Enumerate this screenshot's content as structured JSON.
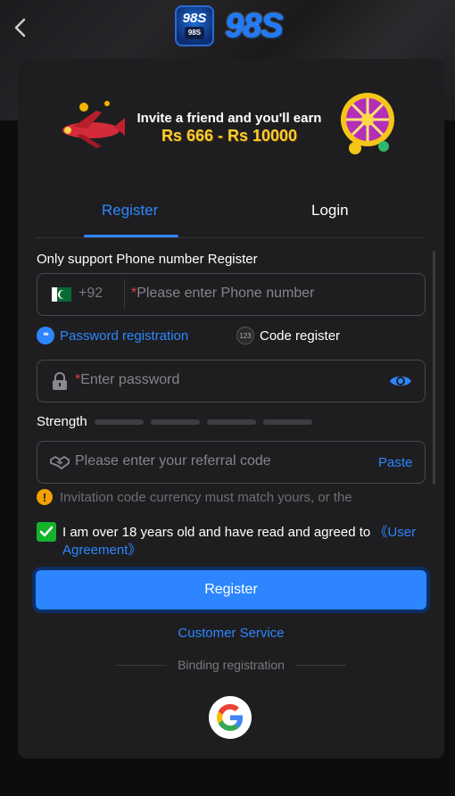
{
  "header": {
    "logo_badge_text": "98S",
    "logo_badge_sub": "98S",
    "logo_text": "98S"
  },
  "banner": {
    "line1": "Invite a friend and you'll earn",
    "line2": "Rs 666 - Rs 10000"
  },
  "tabs": {
    "register": "Register",
    "login": "Login",
    "active": "register"
  },
  "form": {
    "note": "Only support Phone number Register",
    "phone": {
      "country_code": "+92",
      "required_mark": "*",
      "placeholder": "Please enter Phone number"
    },
    "modes": {
      "password_label": "Password registration",
      "password_icon_text": "**",
      "code_label": "Code register",
      "code_icon_text": "123"
    },
    "password": {
      "required_mark": "*",
      "placeholder": "Enter password"
    },
    "strength_label": "Strength",
    "referral": {
      "placeholder": "Please enter your referral code",
      "paste_label": "Paste"
    },
    "warning": "Invitation code currency must match yours, or the",
    "agreement": {
      "text": "I am over 18 years old and have read and agreed to ",
      "link": "《User Agreement》",
      "checked": true
    },
    "submit_label": "Register",
    "customer_service": "Customer Service",
    "binding_label": "Binding registration"
  },
  "colors": {
    "accent": "#2d86ff",
    "check": "#13b32b",
    "warning": "#f0a000",
    "required": "#e53b3b"
  },
  "icons": [
    "back-arrow-icon",
    "pakistan-flag-icon",
    "lock-icon",
    "eye-icon",
    "handshake-icon",
    "warning-icon",
    "check-icon",
    "google-icon"
  ]
}
